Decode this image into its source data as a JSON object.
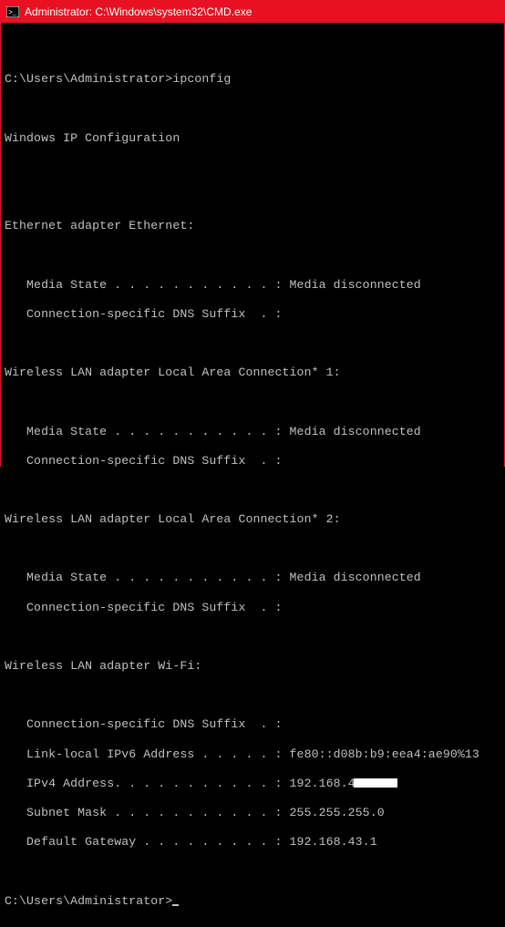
{
  "window": {
    "title": "Administrator: C:\\Windows\\system32\\CMD.exe"
  },
  "prompt": "C:\\Users\\Administrator>",
  "command": "ipconfig",
  "output": {
    "header": "Windows IP Configuration",
    "adapters": [
      {
        "name": "Ethernet adapter Ethernet:",
        "lines": [
          {
            "label": "   Media State . . . . . . . . . . . : ",
            "value": "Media disconnected"
          },
          {
            "label": "   Connection-specific DNS Suffix  . :",
            "value": ""
          }
        ]
      },
      {
        "name": "Wireless LAN adapter Local Area Connection* 1:",
        "lines": [
          {
            "label": "   Media State . . . . . . . . . . . : ",
            "value": "Media disconnected"
          },
          {
            "label": "   Connection-specific DNS Suffix  . :",
            "value": ""
          }
        ]
      },
      {
        "name": "Wireless LAN adapter Local Area Connection* 2:",
        "lines": [
          {
            "label": "   Media State . . . . . . . . . . . : ",
            "value": "Media disconnected"
          },
          {
            "label": "   Connection-specific DNS Suffix  . :",
            "value": ""
          }
        ]
      },
      {
        "name": "Wireless LAN adapter Wi-Fi:",
        "lines": [
          {
            "label": "   Connection-specific DNS Suffix  . :",
            "value": ""
          },
          {
            "label": "   Link-local IPv6 Address . . . . . : ",
            "value": "fe80::d08b:b9:eea4:ae90%13"
          },
          {
            "label": "   IPv4 Address. . . . . . . . . . . : ",
            "value": "192.168.4",
            "redacted_suffix": true
          },
          {
            "label": "   Subnet Mask . . . . . . . . . . . : ",
            "value": "255.255.255.0"
          },
          {
            "label": "   Default Gateway . . . . . . . . . : ",
            "value": "192.168.43.1"
          }
        ]
      }
    ]
  }
}
